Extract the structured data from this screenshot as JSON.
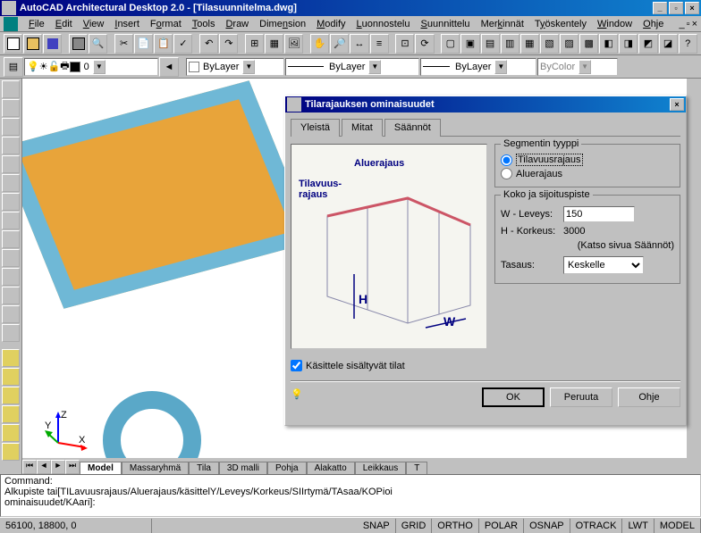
{
  "app": {
    "title": "AutoCAD Architectural Desktop 2.0 - [Tilasuunnitelma.dwg]"
  },
  "menu": [
    {
      "label": "File",
      "key": "F"
    },
    {
      "label": "Edit",
      "key": "E"
    },
    {
      "label": "View",
      "key": "V"
    },
    {
      "label": "Insert",
      "key": "I"
    },
    {
      "label": "Format",
      "key": "o"
    },
    {
      "label": "Tools",
      "key": "T"
    },
    {
      "label": "Draw",
      "key": "D"
    },
    {
      "label": "Dimension",
      "key": "n"
    },
    {
      "label": "Modify",
      "key": "M"
    },
    {
      "label": "Luonnostelu",
      "key": "L"
    },
    {
      "label": "Suunnittelu",
      "key": "S"
    },
    {
      "label": "Merkinnät",
      "key": "k"
    },
    {
      "label": "Työskentely",
      "key": "y"
    },
    {
      "label": "Window",
      "key": "W"
    },
    {
      "label": "Ohje",
      "key": "O"
    }
  ],
  "props": {
    "layer": "0",
    "color": "ByLayer",
    "linetype": "ByLayer",
    "lineweight": "ByLayer",
    "plotstyle": "ByColor"
  },
  "viewport_tabs": [
    "Model",
    "Massaryhmä",
    "Tila",
    "3D malli",
    "Pohja",
    "Alakatto",
    "Leikkaus",
    "T"
  ],
  "viewport_active_tab": "Model",
  "coord_axes": {
    "x": "X",
    "y": "Y",
    "z": "Z"
  },
  "dialog": {
    "title": "Tilarajauksen ominaisuudet",
    "tabs": [
      "Yleistä",
      "Mitat",
      "Säännöt"
    ],
    "active_tab": "Mitat",
    "image_labels": {
      "aluerajaus": "Aluerajaus",
      "tilavuusrajaus": "Tilavuus-\nrajaus",
      "H": "H",
      "W": "W"
    },
    "segment_group": "Segmentin tyyppi",
    "radio_tilavuus": "Tilavuusrajaus",
    "radio_alue": "Aluerajaus",
    "size_group": "Koko ja sijoituspiste",
    "width_label": "W - Leveys:",
    "width_value": "150",
    "height_label": "H - Korkeus:",
    "height_value": "3000",
    "height_note": "(Katso sivua Säännöt)",
    "align_label": "Tasaus:",
    "align_value": "Keskelle",
    "checkbox": "Käsittele sisältyvät tilat",
    "ok": "OK",
    "cancel": "Peruuta",
    "help": "Ohje"
  },
  "command": {
    "line1": "Command:",
    "line2": "Alkupiste tai[TILavuusrajaus/Aluerajaus/käsittelY/Leveys/Korkeus/SIIrtymä/TAsaa/KOPioi",
    "line3": "ominaisuudet/KAari]:"
  },
  "status": {
    "coords": "56100, 18800, 0",
    "toggles": [
      "SNAP",
      "GRID",
      "ORTHO",
      "POLAR",
      "OSNAP",
      "OTRACK",
      "LWT",
      "MODEL"
    ]
  }
}
